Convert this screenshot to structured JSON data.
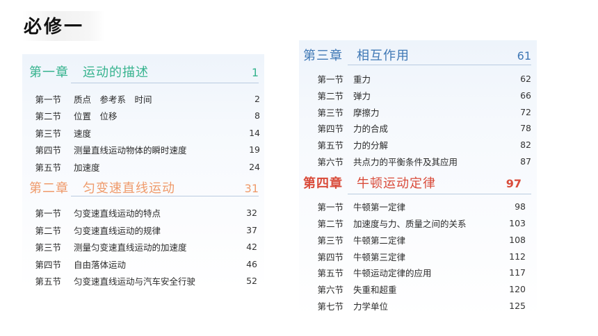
{
  "page_title": "必修一",
  "left_panel": {
    "chapters": [
      {
        "number": "第一章",
        "title": "运动的描述",
        "page": "1",
        "color": "#36b38e",
        "sections": [
          {
            "number": "第一节",
            "title": "质点　参考系　时间",
            "page": "2"
          },
          {
            "number": "第二节",
            "title": "位置　位移",
            "page": "8"
          },
          {
            "number": "第三节",
            "title": "速度",
            "page": "14"
          },
          {
            "number": "第四节",
            "title": "测量直线运动物体的瞬时速度",
            "page": "19"
          },
          {
            "number": "第五节",
            "title": "加速度",
            "page": "24"
          }
        ]
      },
      {
        "number": "第二章",
        "title": "匀变速直线运动",
        "page": "31",
        "color": "#ef9a6a",
        "sections": [
          {
            "number": "第一节",
            "title": "匀变速直线运动的特点",
            "page": "32"
          },
          {
            "number": "第二节",
            "title": "匀变速直线运动的规律",
            "page": "37"
          },
          {
            "number": "第三节",
            "title": "测量匀变速直线运动的加速度",
            "page": "42"
          },
          {
            "number": "第四节",
            "title": "自由落体运动",
            "page": "46"
          },
          {
            "number": "第五节",
            "title": "匀变速直线运动与汽车安全行驶",
            "page": "52"
          }
        ]
      }
    ]
  },
  "right_panel": {
    "chapters": [
      {
        "number": "第三章",
        "title": "相互作用",
        "page": "61",
        "color": "#3f78b5",
        "sections": [
          {
            "number": "第一节",
            "title": "重力",
            "page": "62"
          },
          {
            "number": "第二节",
            "title": "弹力",
            "page": "66"
          },
          {
            "number": "第三节",
            "title": "摩擦力",
            "page": "72"
          },
          {
            "number": "第四节",
            "title": "力的合成",
            "page": "78"
          },
          {
            "number": "第五节",
            "title": "力的分解",
            "page": "82"
          },
          {
            "number": "第六节",
            "title": "共点力的平衡条件及其应用",
            "page": "87"
          }
        ]
      },
      {
        "number": "第四章",
        "title": "牛顿运动定律",
        "page": "97",
        "color": "#d94b3a",
        "sections": [
          {
            "number": "第一节",
            "title": "牛顿第一定律",
            "page": "98"
          },
          {
            "number": "第二节",
            "title": "加速度与力、质量之间的关系",
            "page": "103"
          },
          {
            "number": "第三节",
            "title": "牛顿第二定律",
            "page": "108"
          },
          {
            "number": "第四节",
            "title": "牛顿第三定律",
            "page": "112"
          },
          {
            "number": "第五节",
            "title": "牛顿运动定律的应用",
            "page": "117"
          },
          {
            "number": "第六节",
            "title": "失重和超重",
            "page": "120"
          },
          {
            "number": "第七节",
            "title": "力学单位",
            "page": "125"
          }
        ]
      }
    ]
  }
}
